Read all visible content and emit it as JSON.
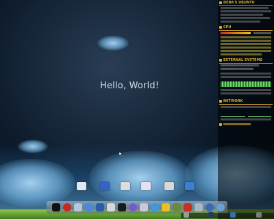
{
  "desktop": {
    "greeting": "Hello, World!"
  },
  "panel": {
    "sections": [
      {
        "title": "DEBA'S UBUNTU"
      },
      {
        "title": "CPU"
      },
      {
        "title": "EXTERNAL SYSTEMS"
      },
      {
        "title": "NETWORK"
      }
    ]
  },
  "taskbar": {
    "icons": [
      "terminal-icon",
      "opera-icon",
      "settings-icon",
      "finder-icon",
      "monitor-icon",
      "doc-icon",
      "mail-icon",
      "penguin-icon",
      "network-icon",
      "search-icon",
      "skype-icon",
      "folder-icon",
      "notes-icon",
      "package-icon",
      "filezilla-icon",
      "sync-icon",
      "drop-icon",
      "cube-icon",
      "disk-icon"
    ]
  },
  "colors": {
    "accent": "#d9ad2c",
    "panel_text": "#e6e6e6",
    "graph_green": "#6fd36f",
    "graph_red": "#d23a2a"
  }
}
